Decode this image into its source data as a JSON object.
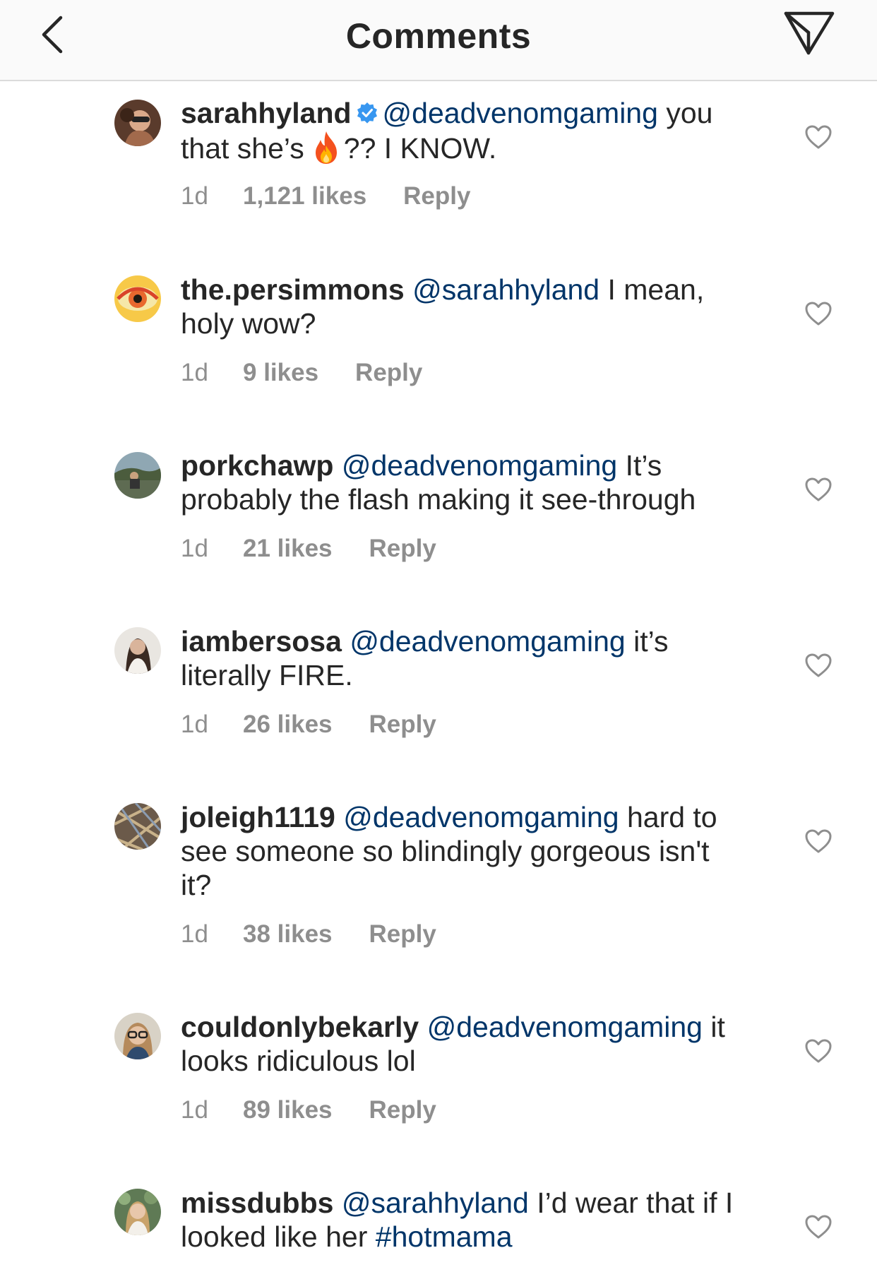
{
  "header": {
    "title": "Comments",
    "back_icon": "chevron-left-icon",
    "send_icon": "paper-plane-icon"
  },
  "comments": [
    {
      "username": "sarahhyland",
      "verified": true,
      "mention": "@deadvenomgaming",
      "text1": " you",
      "line2a": "that she’s",
      "line2b": "?? I KNOW.",
      "emoji": "fire-emoji",
      "time": "1d",
      "likes": "1,121 likes",
      "reply": "Reply"
    },
    {
      "username": "the.persimmons",
      "mention": "@sarahhyland",
      "text1": " I mean,",
      "line2": "holy wow?",
      "time": "1d",
      "likes": "9 likes",
      "reply": "Reply"
    },
    {
      "username": "porkchawp",
      "mention": "@deadvenomgaming",
      "text1": " It’s",
      "line2": "probably the flash making it see-through",
      "time": "1d",
      "likes": "21 likes",
      "reply": "Reply"
    },
    {
      "username": "iambersosa",
      "mention": "@deadvenomgaming",
      "text1": " it’s",
      "line2": "literally FIRE.",
      "time": "1d",
      "likes": "26 likes",
      "reply": "Reply"
    },
    {
      "username": "joleigh1119",
      "mention": "@deadvenomgaming",
      "text1": " hard to",
      "line2": "see someone so blindingly gorgeous isn't",
      "line3": "it?",
      "time": "1d",
      "likes": "38 likes",
      "reply": "Reply"
    },
    {
      "username": "couldonlybekarly",
      "mention": "@deadvenomgaming",
      "text1": " it",
      "line2": "looks ridiculous lol",
      "time": "1d",
      "likes": "89 likes",
      "reply": "Reply"
    },
    {
      "username": "missdubbs",
      "mention": "@sarahhyland",
      "text1": " I’d wear that if I",
      "line2": "looked like her ",
      "hashtag": "#hotmama"
    }
  ],
  "colors": {
    "mention": "#003569",
    "meta": "#8e8e8e",
    "verified": "#3897f0",
    "header_bg": "#fafafa"
  }
}
